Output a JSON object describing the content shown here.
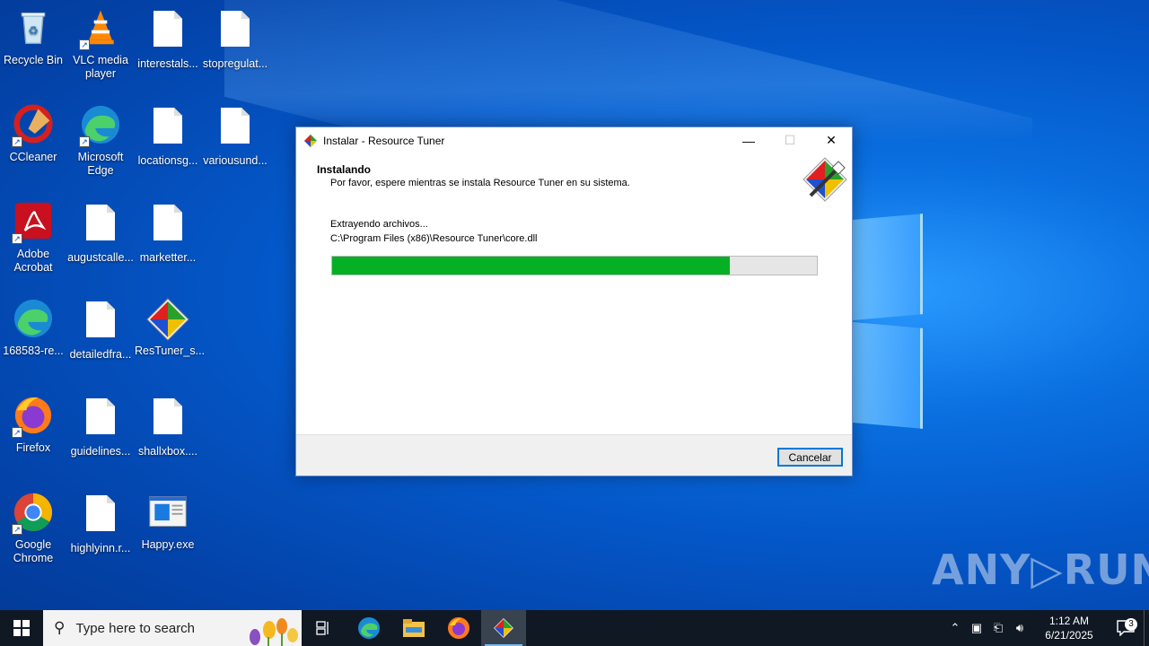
{
  "desktop": {
    "icons": [
      {
        "label": "Recycle Bin",
        "icon": "recycle-bin-icon"
      },
      {
        "label": "VLC media player",
        "icon": "vlc-icon"
      },
      {
        "label": "interestals...",
        "icon": "document-icon"
      },
      {
        "label": "stopregulat...",
        "icon": "document-icon"
      },
      {
        "label": "CCleaner",
        "icon": "ccleaner-icon"
      },
      {
        "label": "Microsoft Edge",
        "icon": "edge-icon"
      },
      {
        "label": "locationsg...",
        "icon": "document-icon"
      },
      {
        "label": "variousund...",
        "icon": "document-icon"
      },
      {
        "label": "Adobe Acrobat",
        "icon": "acrobat-icon"
      },
      {
        "label": "augustcalle...",
        "icon": "document-icon"
      },
      {
        "label": "marketter...",
        "icon": "document-icon"
      },
      {
        "label": "168583-re...",
        "icon": "edge-icon"
      },
      {
        "label": "detailedfra...",
        "icon": "document-icon"
      },
      {
        "label": "ResTuner_s...",
        "icon": "restuner-icon"
      },
      {
        "label": "Firefox",
        "icon": "firefox-icon"
      },
      {
        "label": "guidelines...",
        "icon": "document-icon"
      },
      {
        "label": "shallxbox....",
        "icon": "document-icon"
      },
      {
        "label": "Google Chrome",
        "icon": "chrome-icon"
      },
      {
        "label": "highlyinn.r...",
        "icon": "document-icon"
      },
      {
        "label": "Happy.exe",
        "icon": "exe-icon"
      }
    ]
  },
  "window": {
    "title": "Instalar - Resource Tuner",
    "minimize": "—",
    "maximize": "☐",
    "close": "✕",
    "header_title": "Instalando",
    "header_subtitle": "Por favor, espere mientras se instala Resource Tuner en su sistema.",
    "status_line": "Extrayendo archivos...",
    "file_path": "C:\\Program Files (x86)\\Resource Tuner\\core.dll",
    "progress_fraction": 0.82,
    "progress_color": "#06b025",
    "cancel_label": "Cancelar"
  },
  "watermark": "ANY▷RUN",
  "taskbar": {
    "search_placeholder": "Type here to search",
    "apps": [
      "task-view-icon",
      "edge-icon",
      "file-explorer-icon",
      "firefox-icon",
      "resource-tuner-icon"
    ],
    "clock_time": "1:12 AM",
    "clock_date": "6/21/2025",
    "notification_count": "3"
  }
}
